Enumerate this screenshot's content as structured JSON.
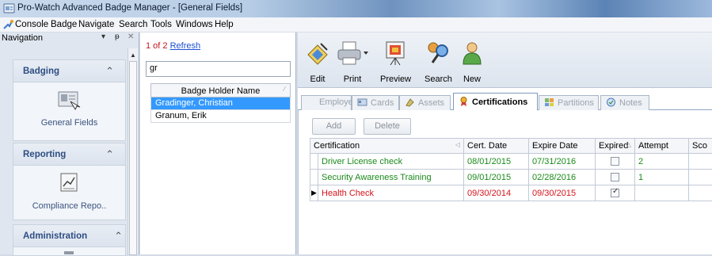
{
  "window": {
    "title": "Pro-Watch Advanced Badge Manager - [General Fields]"
  },
  "menu": [
    "Console",
    "Badge",
    "Navigate",
    "Search",
    "Tools",
    "Windows",
    "Help"
  ],
  "navigation": {
    "title": "Navigation",
    "groups": [
      {
        "title": "Badging",
        "item": "General Fields",
        "icon": "badge-fields-icon"
      },
      {
        "title": "Reporting",
        "item": "Compliance Repo..",
        "icon": "report-icon"
      },
      {
        "title": "Administration",
        "item": "",
        "icon": "admin-icon"
      }
    ]
  },
  "records": {
    "position": "1 of 2",
    "refresh_label": "Refresh",
    "search_value": "gr",
    "column_header": "Badge Holder Name",
    "rows": [
      "Gradinger, Christian",
      "Granum, Erik"
    ],
    "selected_index": 0
  },
  "toolbar": [
    "Edit",
    "Print",
    "Preview",
    "Search",
    "New"
  ],
  "tabs": [
    {
      "label": "Employee",
      "icon": "employee-icon",
      "active": false
    },
    {
      "label": "Cards",
      "icon": "cards-icon",
      "active": false
    },
    {
      "label": "Assets",
      "icon": "assets-icon",
      "active": false
    },
    {
      "label": "Certifications",
      "icon": "certifications-icon",
      "active": true
    },
    {
      "label": "Partitions",
      "icon": "partitions-icon",
      "active": false
    },
    {
      "label": "Notes",
      "icon": "notes-icon",
      "active": false
    }
  ],
  "certifications": {
    "add_label": "Add",
    "delete_label": "Delete",
    "columns": [
      "Certification",
      "Cert. Date",
      "Expire Date",
      "Expired",
      "Attempt",
      "Sco"
    ],
    "rows": [
      {
        "certification": "Driver License check",
        "cert_date": "08/01/2015",
        "expire_date": "07/31/2016",
        "expired": false,
        "attempt": "2",
        "status_color": "#1a8a1a"
      },
      {
        "certification": "Security Awareness Training",
        "cert_date": "09/01/2015",
        "expire_date": "02/28/2016",
        "expired": false,
        "attempt": "1",
        "status_color": "#1a8a1a"
      },
      {
        "certification": "Health Check",
        "cert_date": "09/30/2014",
        "expire_date": "09/30/2015",
        "expired": true,
        "attempt": "",
        "status_color": "#d4141b"
      }
    ]
  }
}
